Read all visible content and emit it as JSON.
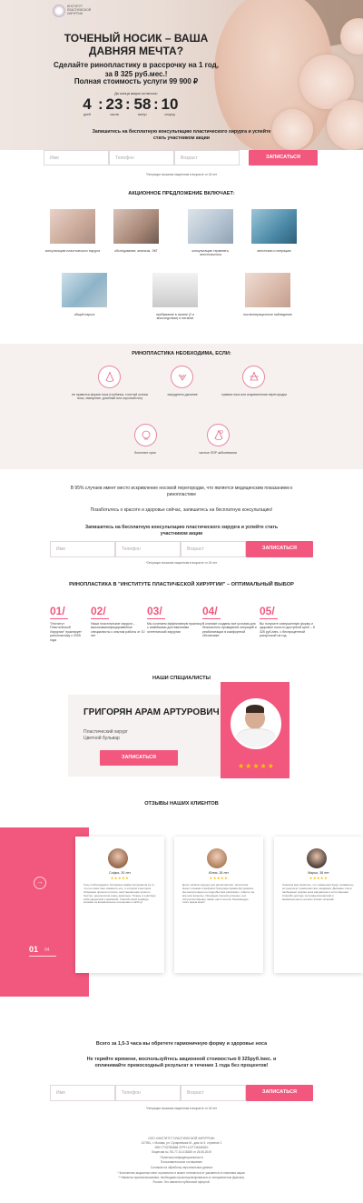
{
  "brand": {
    "logo_text": "ИНСТИТУТ ПЛАСТИЧЕСКОЙ ХИРУРГИИ"
  },
  "hero": {
    "title": "ТОЧЕНЫЙ НОСИК – ВАША ДАВНЯЯ МЕЧТА?",
    "subtitle": "Сделайте ринопластику в рассрочку на 1 год, за 8 325 руб.мес.!",
    "full_price": "Полная стоимость услуги 99 900 ₽",
    "countdown_label": "До конца акции осталось:",
    "countdown": {
      "days": "4",
      "hours": "23",
      "minutes": "58",
      "seconds": "10",
      "days_label": "дней",
      "hours_label": "часов",
      "minutes_label": "минут",
      "seconds_label": "секунд"
    },
    "cta": "Запишитесь на бесплатную консультацию пластического хирурга и успейте стать участником акции"
  },
  "form": {
    "name_placeholder": "Имя",
    "phone_placeholder": "Телефон",
    "age_placeholder": "Возраст",
    "submit": "ЗАПИСАТЬСЯ",
    "note": "*Операция показана пациентам в возрасте от 18 лет"
  },
  "offer": {
    "title": "АКЦИОННОЕ ПРЕДЛОЖЕНИЕ ВКЛЮЧАЕТ:",
    "items": [
      "консультацию пластического хирурга",
      "обследование, анализы, ЭКГ",
      "консультацию терапевта, анестезиолога",
      "анестезию и операцию",
      "общий наркоз",
      "пребывание в палате (2 и впоследствии) и питание",
      "послеоперационное наблюдение"
    ]
  },
  "need": {
    "title": "РИНОПЛАСТИКА НЕОБХОДИМА, ЕСЛИ:",
    "items": [
      "не нравится форма носа (горбинка, толстый кончик носа, смещение, длинный или короткий нос)",
      "затруднено дыхание",
      "травма носа или искривленная перегородка",
      "болезнит храп",
      "частые ЛОР заболевания"
    ]
  },
  "info": {
    "line1": "В 95% случаев имеет место искривление носовой перегородки, что является медицинским показанием к ринопластике",
    "line2": "Позаботьтесь о красоте и здоровье сейчас, запишитесь на бесплатную консультацию!",
    "cta": "Запишитесь на бесплатную консультацию пластического хирурга и успейте стать участником акции"
  },
  "why": {
    "title": "РИНОПЛАСТИКА В \"ИНСТИТУТЕ ПЛАСТИЧЕСКОЙ ХИРУРГИИ\" – ОПТИМАЛЬНЫЙ ВЫБОР",
    "items": [
      {
        "num": "01/",
        "text": "\"Институт Пластической Хирургии\" практикует ринопластику с 2005 года"
      },
      {
        "num": "02/",
        "text": "Наши пластические хирурги – высококвалифицированные специалисты с опытом работы от 10 лет"
      },
      {
        "num": "03/",
        "text": "Мы сочетаем эффективную практику с новейшими достижениями эстетической хирургии"
      },
      {
        "num": "04/",
        "text": "В клинике созданы все условия для безопасного проведения операций и реабилитации в комфортной обстановке"
      },
      {
        "num": "05/",
        "text": "Вы получите совершенную форму и здоровье носа по доступной цене – 8 325 руб./мес. с беспроцентной рассрочкой на год"
      }
    ]
  },
  "specialists": {
    "title": "НАШИ СПЕЦИАЛИСТЫ",
    "name": "ГРИГОРЯН АРАМ АРТУРОВИЧ",
    "role": "Пластический хирург",
    "location": "Цветной бульвар",
    "button": "ЗАПИСАТЬСЯ",
    "stars": "★★★★★"
  },
  "reviews": {
    "title": "ОТЗЫВЫ НАШИХ КЛИЕНТОВ",
    "counter_current": "01",
    "counter_total": "04",
    "arrow": "→",
    "items": [
      {
        "name": "Софья, 30 лет",
        "stars": "★★★★★",
        "text": "Хочу поблагодарить Григоряна Арама Артуровича за то, что он помог мне изменить нос, о котором я мечтала. Операция прошла отлично, восстановление прошло быстро, результатом очень довольна. Теперь я чувствую себя уверенной и красивой. Спасибо всей команде клиники за внимательное отношение и заботу!"
      },
      {
        "name": "Юлия, 26 лет",
        "stars": "★★★★★",
        "text": "Долго искала хирурга для ринопластики, прочитала много отзывов и выбрала Григоряна Арама Артуровича. На консультации он подробно всё рассказал, ответил на все мои вопросы. Операция прошла успешно, нос получился именно таким, как я хотела. Рекомендую этого врача всем!"
      },
      {
        "name": "Марья, 38 лет",
        "stars": "★★★★★",
        "text": "Сначала мне казалось, что изменения будут незаметны, но результат превзошёл все ожидания. Дыхание стало свободным, форма носа аккуратная и естественная. Спасибо доктору за профессионализм и внимательность на всех этапах лечения!"
      }
    ]
  },
  "final": {
    "line1": "Всего за 1,5-3 часа вы обретете гармоничную форму и здоровье носа",
    "line2": "Не теряйте времени, воспользуйтесь акционной стоимостью 8 325руб./мес. и оплачивайте превосходный результат в течение 1 года без процентов!"
  },
  "footer": {
    "lines": [
      "ООО «ИНСТИТУТ ПЛАСТИЧЕСКОЙ ХИРУРГИИ»",
      "127051, г. Москва, ул. Сухаревская М., дом № 9, строение 1",
      "ИНН 7702786668 ОГРН 1127746180840",
      "Лицензия № ЛО-77-01-018185 от 26.06.2019",
      "Политика конфиденциальности",
      "Пользовательское соглашение",
      "Согласие на обработку персональных данных",
      "* Количество акционных мест ограничено и может отличаться от указанного в описании акции.",
      "** Имеются противопоказания, необходимо проконсультироваться со специалистом (врачом).",
      "Россия. Это является публичной офертой."
    ]
  }
}
